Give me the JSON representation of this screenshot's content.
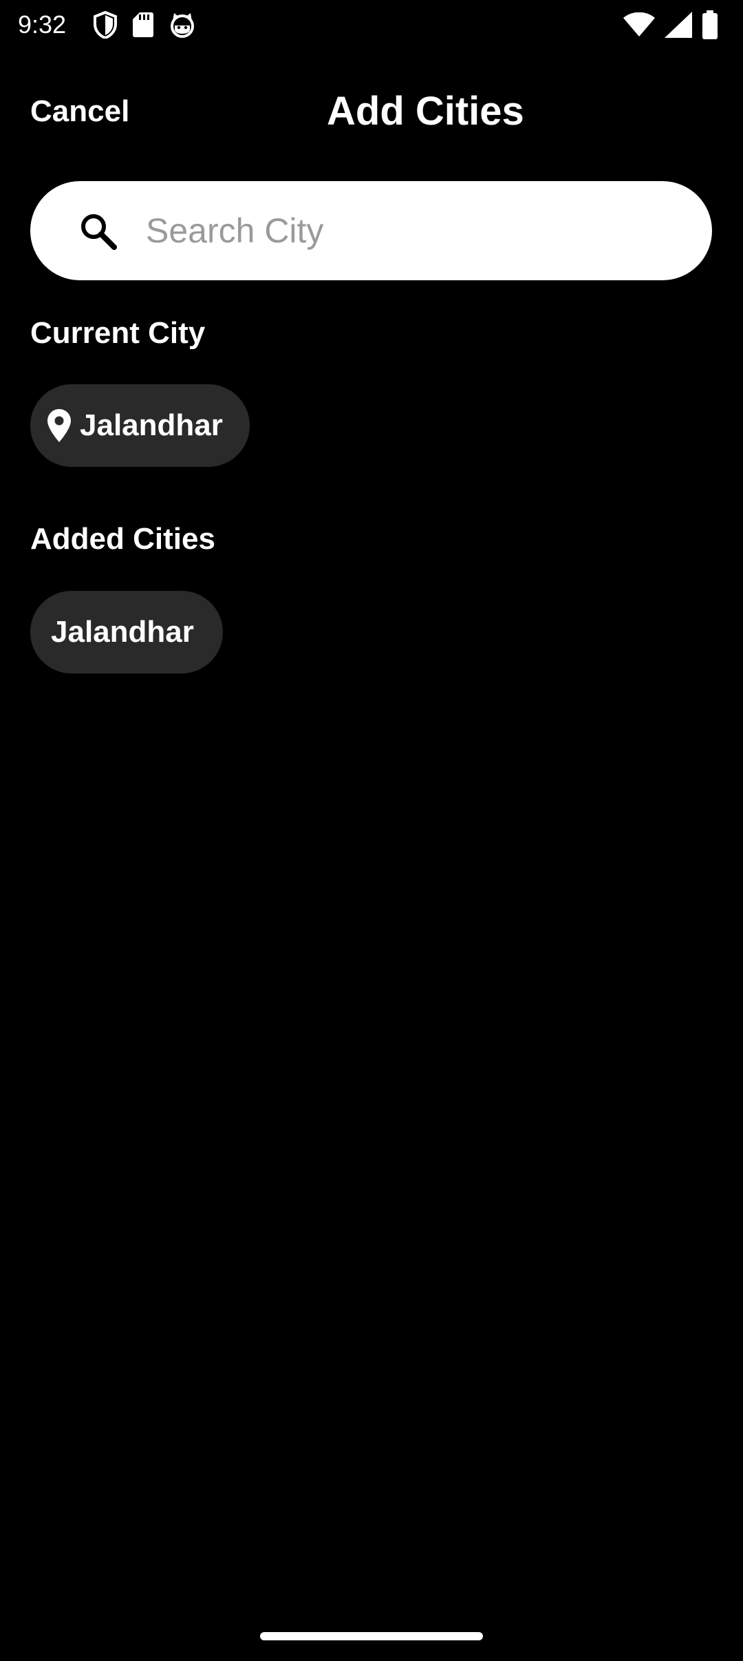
{
  "status_bar": {
    "time": "9:32",
    "left_icons": [
      "shield-icon",
      "sd-card-icon",
      "cat-face-icon"
    ],
    "right_icons": [
      "wifi-icon",
      "cellular-signal-icon",
      "battery-icon"
    ]
  },
  "header": {
    "cancel_label": "Cancel",
    "title": "Add Cities"
  },
  "search": {
    "value": "",
    "placeholder": "Search City",
    "icon": "search-icon"
  },
  "current_city": {
    "heading": "Current City",
    "city": "Jalandhar",
    "icon": "location-pin-icon"
  },
  "added_cities": {
    "heading": "Added Cities",
    "items": [
      {
        "label": "Jalandhar"
      }
    ]
  },
  "colors": {
    "background": "#000000",
    "chip_background": "#2a2a2a",
    "search_background": "#ffffff",
    "placeholder": "#9a9a9a",
    "text": "#ffffff"
  }
}
